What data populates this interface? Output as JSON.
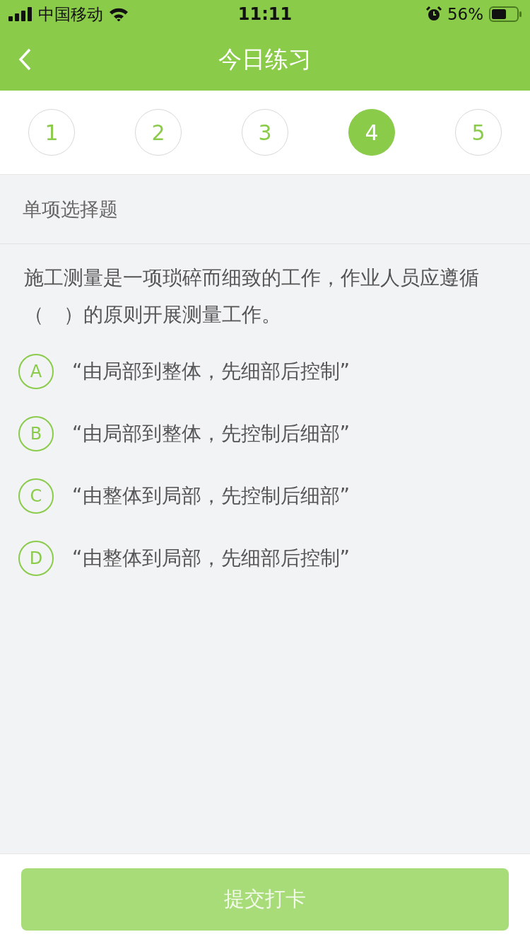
{
  "status_bar": {
    "carrier": "中国移动",
    "time": "11:11",
    "battery": "56%"
  },
  "nav": {
    "title": "今日练习"
  },
  "steps": [
    {
      "label": "1",
      "selected": false
    },
    {
      "label": "2",
      "selected": false
    },
    {
      "label": "3",
      "selected": false
    },
    {
      "label": "4",
      "selected": true
    },
    {
      "label": "5",
      "selected": false
    }
  ],
  "question_type": "单项选择题",
  "question": "施工测量是一项琐碎而细致的工作，作业人员应遵循（　）的原则开展测量工作。",
  "options": [
    {
      "letter": "A",
      "text": "“由局部到整体，先细部后控制”",
      "selected": false
    },
    {
      "letter": "B",
      "text": "“由局部到整体，先控制后细部”",
      "selected": false
    },
    {
      "letter": "C",
      "text": "“由整体到局部，先控制后细部”",
      "selected": false
    },
    {
      "letter": "D",
      "text": "“由整体到局部，先细部后控制”",
      "selected": false
    }
  ],
  "submit": {
    "label": "提交打卡",
    "disabled": true
  }
}
